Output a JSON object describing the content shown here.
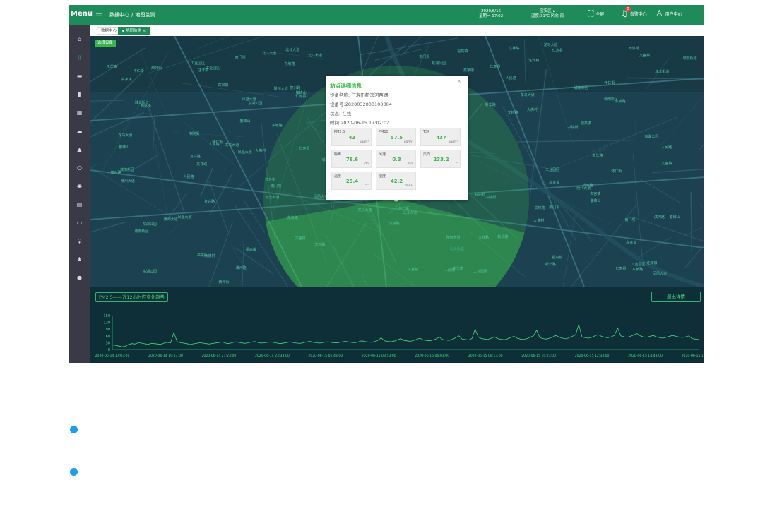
{
  "topbar": {
    "menu_label": "Menu",
    "breadcrumb_parent": "数据中心",
    "breadcrumb_sep": "/",
    "breadcrumb_current": "地图监测",
    "date": "2020/6/15",
    "weekday_time": "星期一 17:02",
    "district": "宝安区",
    "weather": "温度:31℃ 风向:南",
    "fullscreen_label": "全屏",
    "alarm_label": "告警中心",
    "alarm_count": "0",
    "user_label": "用户中心"
  },
  "tabs": [
    {
      "label": "数据中心"
    },
    {
      "label": "地图监测"
    }
  ],
  "tab_close": "×",
  "map": {
    "select_button": "选择设备",
    "labels": [
      "仁寿县",
      "东湖公园",
      "新华路",
      "人民路",
      "城北街道",
      "滨河路",
      "凤凰大道",
      "文林路",
      "南门坝",
      "怀仁街",
      "鳌峰山",
      "文宫镇",
      "书院街",
      "东坡路",
      "陵州大道",
      "工业园区",
      "西外街",
      "龙马大道",
      "北斗大道",
      "高家镇",
      "汪洋镇",
      "城南新区",
      "大佛村",
      "复兴路",
      "视高镇"
    ]
  },
  "popup": {
    "title": "站点详细信息",
    "close": "×",
    "device_name": "设备名称: 仁寿田都滨河西湖",
    "device_no": "设备号:2020032003100004",
    "status": "状态: 在线",
    "time": "时间:2020-06-15 17:02:02",
    "cards": [
      {
        "name": "PM2.5",
        "value": "43",
        "unit": "ug/m³"
      },
      {
        "name": "PM10",
        "value": "57.5",
        "unit": "ug/m³"
      },
      {
        "name": "TSP",
        "value": "437",
        "unit": "ug/m³"
      },
      {
        "name": "噪声",
        "value": "78.6",
        "unit": "db"
      },
      {
        "name": "风速",
        "value": "0.3",
        "unit": "m/s"
      },
      {
        "name": "风向",
        "value": "233.2",
        "unit": "°"
      },
      {
        "name": "温度",
        "value": "29.4",
        "unit": "℃"
      },
      {
        "name": "湿度",
        "value": "42.2",
        "unit": "%RH"
      }
    ]
  },
  "trend": {
    "title": "PM2.5——近12小时内变化趋势",
    "exit_button": "退出详情"
  },
  "chart_data": {
    "type": "line",
    "title": "PM2.5——近12小时内变化趋势",
    "ylim": [
      0,
      150
    ],
    "yticks": [
      0,
      30,
      60,
      90,
      120,
      150
    ],
    "xticks": [
      "2020-06-14 17:03:00",
      "2020-06-14 19:13:00",
      "2020-06-14 21:23:00",
      "2020-06-14 23:33:00",
      "2020-06-15 01:43:00",
      "2020-06-15 03:53:00",
      "2020-06-15 06:03:00",
      "2020-06-15 08:13:00",
      "2020-06-15 10:23:00",
      "2020-06-15 12:33:00",
      "2020-06-15 14:43:00",
      "2020-06-15 16:53:00"
    ],
    "series": [
      {
        "values": [
          20,
          18,
          15,
          12,
          14,
          22,
          26,
          24,
          30,
          28,
          25,
          22,
          27,
          26,
          24,
          23,
          28,
          32,
          29,
          75,
          35,
          30,
          28,
          26,
          22,
          25,
          27,
          30,
          28,
          26,
          24,
          27,
          29,
          31,
          33,
          28,
          26,
          30,
          34,
          32,
          29,
          27,
          30,
          33,
          35,
          31,
          28,
          30,
          32,
          34,
          30,
          28,
          26,
          29,
          31,
          34,
          30,
          28,
          27,
          30,
          33,
          36,
          32,
          30,
          28,
          31,
          34,
          33,
          30,
          29,
          31,
          34,
          36,
          33,
          31,
          30,
          34,
          38,
          35,
          33,
          32,
          35,
          40,
          52,
          38,
          36,
          34,
          37,
          42,
          48,
          40,
          38,
          36,
          40,
          45,
          50,
          42,
          40,
          38,
          42,
          47,
          55,
          44,
          42,
          40,
          45,
          52,
          60,
          46,
          44,
          42,
          48,
          90,
          55,
          48,
          46,
          44,
          50,
          56,
          48,
          45,
          43,
          47,
          53,
          58,
          50,
          46,
          44,
          48,
          54,
          60,
          85,
          52,
          48,
          46,
          50,
          56,
          62,
          54,
          50,
          47,
          52,
          58,
          64,
          110,
          56,
          52,
          50,
          54,
          60,
          66,
          58,
          54,
          52,
          56,
          62,
          95,
          60,
          56,
          54,
          58,
          64,
          70,
          60,
          56,
          54,
          58,
          62,
          56,
          52,
          50,
          54,
          58,
          62,
          58,
          55,
          53,
          56,
          60,
          48,
          46,
          44
        ]
      }
    ]
  }
}
